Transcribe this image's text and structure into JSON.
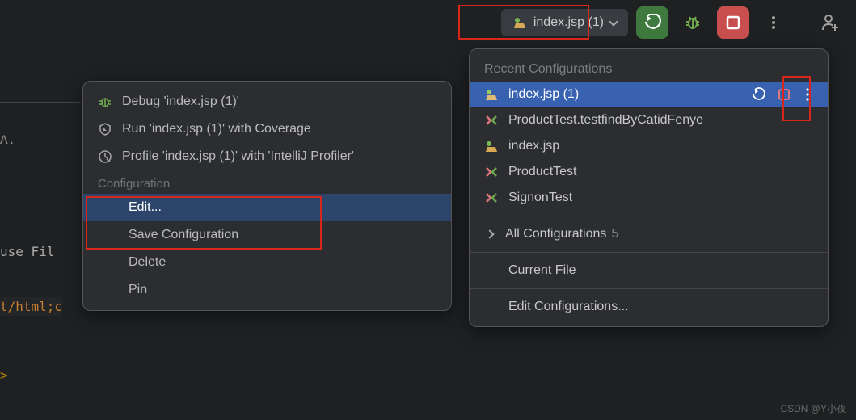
{
  "toolbar": {
    "run_config": "index.jsp (1)"
  },
  "editor": {
    "line1": "A.",
    "line2": " use Fil",
    "line3": "t/html;c",
    "line4": ">"
  },
  "context_menu": {
    "debug": "Debug 'index.jsp (1)'",
    "coverage": "Run 'index.jsp (1)' with Coverage",
    "profile": "Profile 'index.jsp (1)' with 'IntelliJ Profiler'",
    "section": "Configuration",
    "edit": "Edit...",
    "save": "Save Configuration",
    "delete": "Delete",
    "pin": "Pin"
  },
  "dropdown": {
    "header": "Recent Configurations",
    "items": [
      {
        "label": "index.jsp (1)"
      },
      {
        "label": "ProductTest.testfindByCatidFenye"
      },
      {
        "label": "index.jsp"
      },
      {
        "label": "ProductTest"
      },
      {
        "label": "SignonTest"
      }
    ],
    "all_configs": "All Configurations",
    "all_count": "5",
    "current_file": "Current File",
    "edit_configs": "Edit Configurations..."
  },
  "watermark": "CSDN @Y小夜"
}
